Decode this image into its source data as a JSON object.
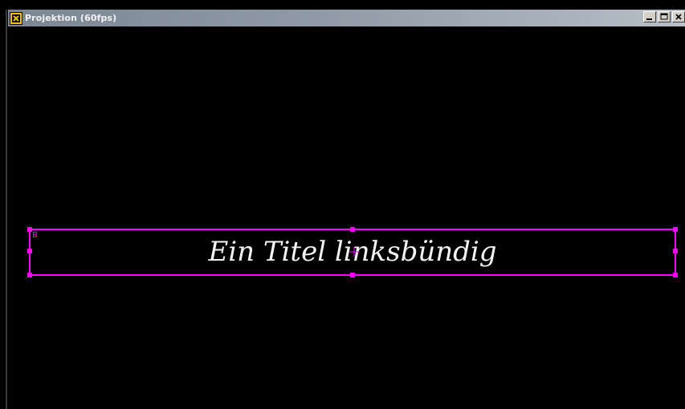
{
  "window": {
    "title": "Projektion (60fps)",
    "icons": {
      "app": "app-icon",
      "minimize": "minimize-icon",
      "maximize": "maximize-icon",
      "close": "close-icon"
    }
  },
  "canvas": {
    "text_box": {
      "label": "B",
      "text": "Ein Titel linksbündig",
      "outline_color": "#ff00ff",
      "text_color": "#f4f4f4"
    },
    "background_color": "#000000"
  }
}
